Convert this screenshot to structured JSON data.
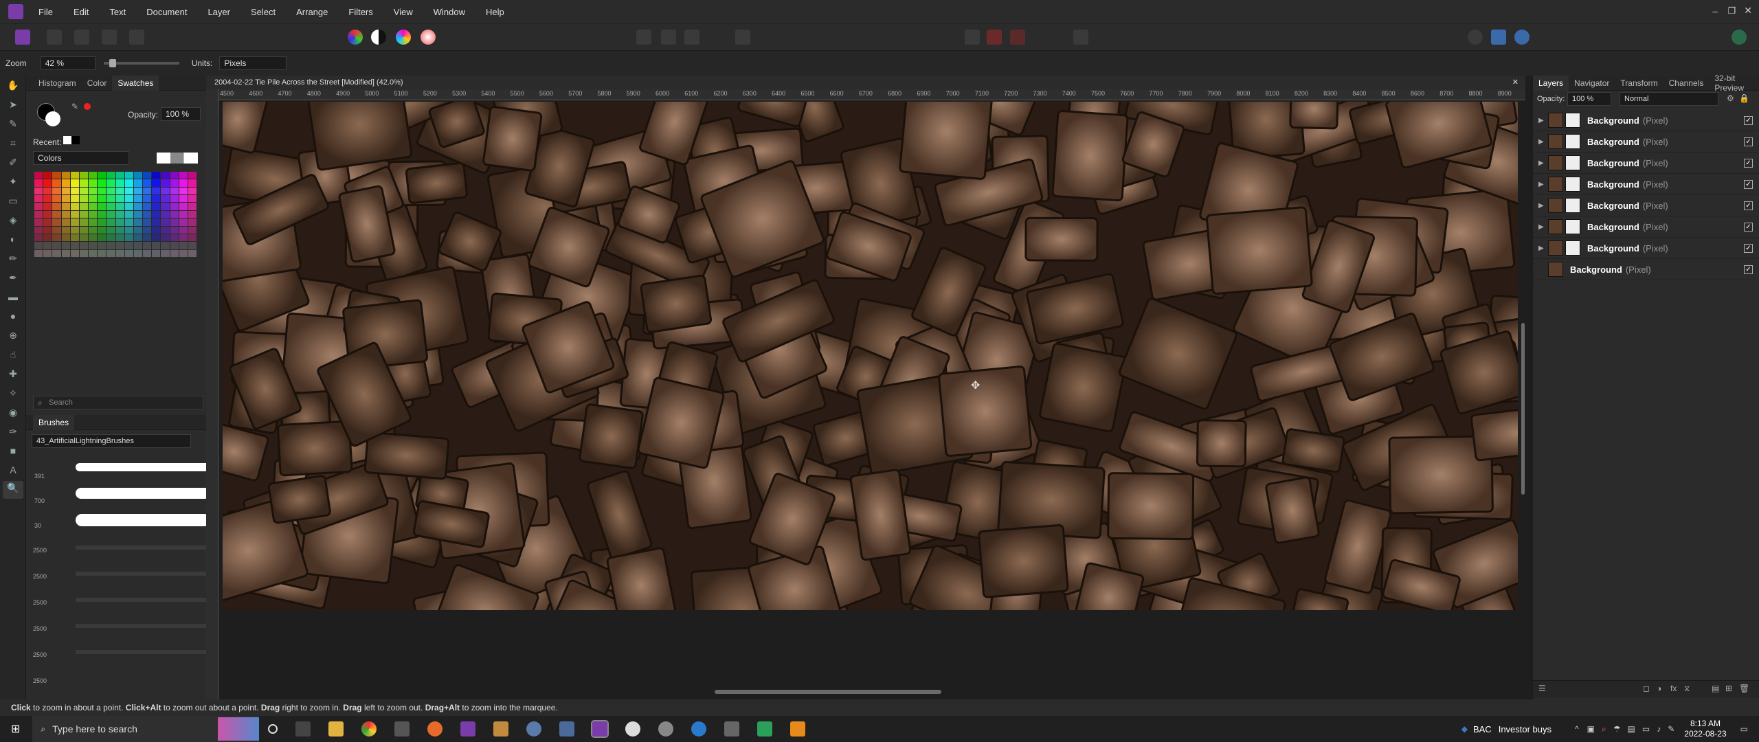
{
  "menu": [
    "File",
    "Edit",
    "Text",
    "Document",
    "Layer",
    "Select",
    "Arrange",
    "Filters",
    "View",
    "Window",
    "Help"
  ],
  "context": {
    "zoom_label": "Zoom",
    "zoom_value": "42 %",
    "units_label": "Units:",
    "units_value": "Pixels"
  },
  "left_panel": {
    "tabs": [
      "Histogram",
      "Color",
      "Swatches"
    ],
    "opacity_label": "Opacity:",
    "opacity_value": "100 %",
    "recent_label": "Recent:",
    "palette_select": "Colors",
    "search_placeholder": "Search",
    "brushes_tab": "Brushes",
    "brush_category": "43_ArtificialLightningBrushes",
    "brush_sizes": [
      "391",
      "700",
      "30",
      "2500",
      "2500",
      "2500",
      "2500",
      "2500",
      "2500"
    ]
  },
  "document": {
    "title": "2004-02-22 Tie Pile Across the Street [Modified] (42.0%)",
    "ruler_labels": [
      "4500",
      "4600",
      "4700",
      "4800",
      "4900",
      "5000",
      "5100",
      "5200",
      "5300",
      "5400",
      "5500",
      "5600",
      "5700",
      "5800",
      "5900",
      "6000",
      "6100",
      "6200",
      "6300",
      "6400",
      "6500",
      "6600",
      "6700",
      "6800",
      "6900",
      "7000",
      "7100",
      "7200",
      "7300",
      "7400",
      "7500",
      "7600",
      "7700",
      "7800",
      "7900",
      "8000",
      "8100",
      "8200",
      "8300",
      "8400",
      "8500",
      "8600",
      "8700",
      "8800",
      "8900"
    ]
  },
  "right_panel": {
    "tabs": [
      "Layers",
      "Navigator",
      "Transform",
      "Channels",
      "32-bit Preview"
    ],
    "opacity_label": "Opacity:",
    "opacity_value": "100 %",
    "blend_mode": "Normal",
    "layers": [
      {
        "name": "Background",
        "type": "(Pixel)"
      },
      {
        "name": "Background",
        "type": "(Pixel)"
      },
      {
        "name": "Background",
        "type": "(Pixel)"
      },
      {
        "name": "Background",
        "type": "(Pixel)"
      },
      {
        "name": "Background",
        "type": "(Pixel)"
      },
      {
        "name": "Background",
        "type": "(Pixel)"
      },
      {
        "name": "Background",
        "type": "(Pixel)"
      },
      {
        "name": "Background",
        "type": "(Pixel)"
      }
    ]
  },
  "status": {
    "p1": "Click",
    "p2": " to zoom in about a point. ",
    "p3": "Click+Alt",
    "p4": " to zoom out about a point. ",
    "p5": "Drag",
    "p6": " right to zoom in. ",
    "p7": "Drag",
    "p8": " left to zoom out. ",
    "p9": "Drag+Alt",
    "p10": " to zoom into the marquee."
  },
  "taskbar": {
    "search_placeholder": "Type here to search",
    "ticker": "BAC",
    "ticker_text": "Investor buys",
    "time": "8:13 AM",
    "date": "2022-08-23"
  }
}
